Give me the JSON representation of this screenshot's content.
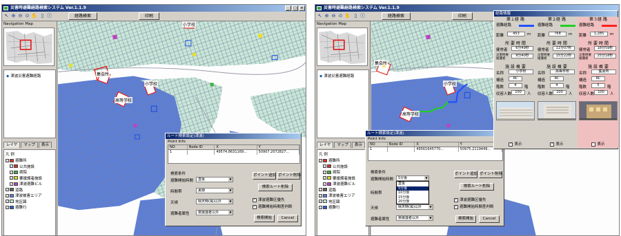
{
  "app": {
    "title": "災害時避難経路検索システム Ver.1.1.9",
    "toolbar": {
      "route_search_label": "経路検索",
      "print_label": "印刷"
    },
    "window_buttons": [
      "_",
      "□",
      "×"
    ]
  },
  "left_panel": {
    "nav_title": "Navigation Map",
    "tree_item": "津波災害避難経路",
    "tabs": [
      "レイヤ",
      "マップ",
      "表示"
    ],
    "legend_title": "凡 例",
    "legend_items": [
      {
        "label": "避難所",
        "checked": true,
        "color": "#e03020"
      },
      {
        "label": "公共施設",
        "checked": true,
        "color": "#d03030"
      },
      {
        "label": "病院",
        "checked": true,
        "color": "#40b040"
      },
      {
        "label": "要援護者施設",
        "checked": true,
        "color": "#e0e020"
      },
      {
        "label": "津波避難ビル",
        "checked": true,
        "color": "#c040c0"
      },
      {
        "label": "道路",
        "checked": true,
        "color": "#606060"
      },
      {
        "label": "津波被害エリア",
        "checked": true,
        "color": "#5a7fd8"
      },
      {
        "label": "地区図",
        "checked": true,
        "color": "#c8e8d8"
      },
      {
        "label": "避難行",
        "checked": true,
        "color": "#2060d0"
      }
    ]
  },
  "map": {
    "labels": [
      "小学校",
      "高等学校",
      "集会所",
      "小学校"
    ],
    "colors": {
      "water": "#ffffff",
      "inundation": "#5a7fd8",
      "district": "#c8e8d8",
      "road": "#8a8aa0"
    }
  },
  "left_dialog": {
    "title": "ルート検索設定(津波)",
    "point_info_label": "Point Info",
    "columns": [
      "NO",
      "Node ID",
      "X",
      "Y"
    ],
    "rows": [
      [
        "1",
        "",
        "49574.8631169...",
        "50907.2072827..."
      ]
    ],
    "conditions_title": "検索条件",
    "add_point_label": "ポイント追加",
    "delete_point_label": "ポイント削除",
    "route_delete_label": "検索ルート削除",
    "start_search_label": "検索開始",
    "cancel_label": "Cancel",
    "fields": [
      {
        "label": "避難開始時間",
        "value": "直後"
      },
      {
        "label": "時間帯",
        "value": "夏期"
      },
      {
        "label": "天候",
        "value": "晴天時(風)以外"
      },
      {
        "label": "避難者属性",
        "value": "要援護者以外"
      }
    ],
    "options": [
      {
        "label": "津波避難区優先",
        "checked": true
      },
      {
        "label": "避難開始時間差判断",
        "checked": true
      }
    ]
  },
  "right_dialog": {
    "title": "ルート検索設定(津波)",
    "point_info_label": "Point Info",
    "columns": [
      "NO",
      "Node ID",
      "X",
      "Y"
    ],
    "rows": [
      [
        "1",
        "",
        "49561645770...",
        "50975.2119449..."
      ]
    ],
    "conditions_title": "検索条件",
    "dropdown_current": "5分後",
    "dropdown_items": [
      "直後",
      "5分後",
      "10分後",
      "15分後",
      "20分後"
    ],
    "dropdown_selected_index": 1,
    "add_point_label": "ポイント追加",
    "delete_point_label": "ポイント削除",
    "route_delete_label": "検索ルート削除",
    "start_search_label": "検索開始",
    "cancel_label": "Cancel",
    "fields": [
      {
        "label": "避難開始時間",
        "value": "5分後"
      },
      {
        "label": "時間帯",
        "value": ""
      },
      {
        "label": "天候",
        "value": "晴天時(風)以外"
      },
      {
        "label": "避難者属性",
        "value": "要援護者以外"
      }
    ],
    "options": [
      {
        "label": "津波避難区優先",
        "checked": true
      },
      {
        "label": "避難開始時間差判断",
        "checked": true
      }
    ]
  },
  "route_panel": {
    "title": "経路情報",
    "routes": [
      {
        "heading": "第１経 路",
        "method": "避難経路",
        "bar_color": "#2050ff",
        "bg": "#d4d0c8",
        "distance": "453",
        "distance_unit": "m",
        "time_title": "所 要 時 間",
        "walk_label": "健常者",
        "walk_value": "6分49秒",
        "assist_label": "災害時要援護者",
        "assist_value": "9分40秒",
        "facility_title": "施 設 概 要",
        "name_label": "名称",
        "name": "小学校",
        "structure_label": "構造",
        "structure": "RC",
        "floors_label": "階数",
        "floors": "4",
        "floors_unit": "階",
        "capacity_label": "収容人数",
        "capacity": "100",
        "capacity_unit": "人",
        "show_label": "表示",
        "show": true
      },
      {
        "heading": "第２経 路",
        "method": "避難経路",
        "bar_color": "#20d020",
        "bg": "#d4d0c8",
        "distance": "768",
        "distance_unit": "m",
        "time_title": "所 要 時 間",
        "walk_label": "健常者",
        "walk_value": "11分07秒",
        "assist_label": "災害時要援護者",
        "assist_value": "15分22秒",
        "facility_title": "施 設 概 要",
        "name_label": "名称",
        "name": "高等学校",
        "structure_label": "構造",
        "structure": "RC",
        "floors_label": "階数",
        "floors": "4",
        "floors_unit": "階",
        "capacity_label": "収容人数",
        "capacity": "100",
        "capacity_unit": "人",
        "show_label": "表示",
        "show": true
      },
      {
        "heading": "第３経 路",
        "method": "避難経路",
        "bar_color": "#ff2020",
        "bg": "#f0c0c0",
        "distance": "1,285",
        "distance_unit": "m",
        "time_title": "所 要 時 間",
        "walk_label": "健常者",
        "walk_value": "18分59秒",
        "assist_label": "災害時要援護者",
        "assist_value": "25分18秒",
        "facility_title": "施 設 概 要",
        "name_label": "名称",
        "name": "集会所",
        "structure_label": "構造",
        "structure": "RC",
        "floors_label": "階数",
        "floors": "5",
        "floors_unit": "階",
        "capacity_label": "収容人数",
        "capacity": "100",
        "capacity_unit": "人",
        "show_label": "表示",
        "show": false
      }
    ]
  }
}
